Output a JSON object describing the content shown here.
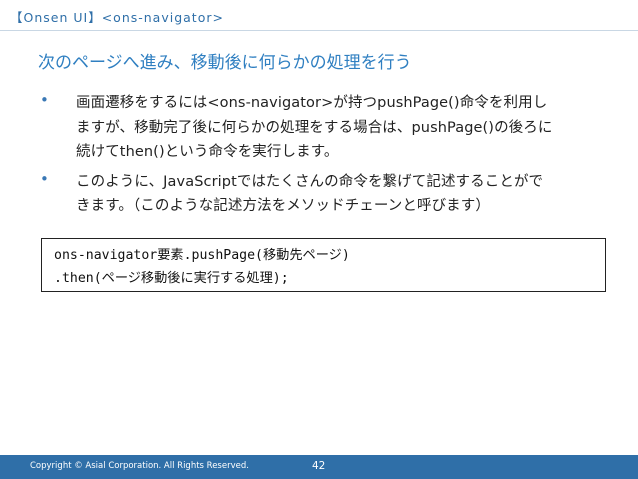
{
  "header": {
    "breadcrumb": "【Onsen UI】<ons-navigator>"
  },
  "slide": {
    "title": "次のページへ進み、移動後に何らかの処理を行う",
    "bullet_marker": "•",
    "bullets": [
      {
        "lines": [
          "画面遷移をするには<ons-navigator>が持つpushPage()命令を利用し",
          "ますが、移動完了後に何らかの処理をする場合は、pushPage()の後ろに",
          "続けてthen()という命令を実行します。"
        ]
      },
      {
        "lines": [
          "このように、JavaScriptではたくさんの命令を繋げて記述することがで",
          "きます。（このような記述方法をメソッドチェーンと呼びます）"
        ]
      }
    ],
    "code": [
      "ons-navigator要素.pushPage(移動先ページ)",
      ".then(ページ移動後に実行する処理);"
    ]
  },
  "footer": {
    "copyright": "Copyright © Asial Corporation. All Rights Reserved.",
    "page_number": "42"
  },
  "colors": {
    "accent": "#2f7fc1",
    "footer_bg": "#2f6fa8",
    "bullet": "#3a78b5"
  }
}
